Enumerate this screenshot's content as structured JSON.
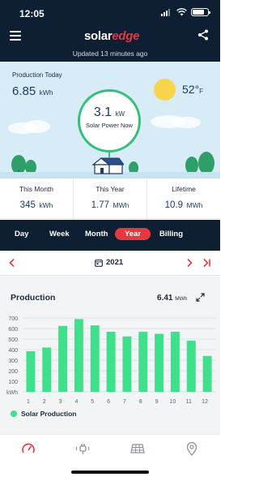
{
  "status_bar": {
    "time": "12:05"
  },
  "header": {
    "brand_left": "solar",
    "brand_right": "edge",
    "updated": "Updated 13 minutes ago",
    "menu_icon": "hamburger-menu-icon",
    "share_icon": "share-icon"
  },
  "hero": {
    "production_label": "Production Today",
    "production_value": "6.85",
    "production_unit": "kWh",
    "temperature": "52°",
    "temperature_unit": "F",
    "weather_icon": "sun-icon",
    "power_value": "3.1",
    "power_unit": "kW",
    "power_label": "Solar Power Now"
  },
  "stats": [
    {
      "label": "This Month",
      "value": "345",
      "unit": "kWh"
    },
    {
      "label": "This Year",
      "value": "1.77",
      "unit": "MWh"
    },
    {
      "label": "Lifetime",
      "value": "10.9",
      "unit": "MWh"
    }
  ],
  "tabs": [
    {
      "label": "Day",
      "active": false
    },
    {
      "label": "Week",
      "active": false
    },
    {
      "label": "Month",
      "active": false
    },
    {
      "label": "Year",
      "active": true
    },
    {
      "label": "Billing",
      "active": false
    }
  ],
  "period_nav": {
    "label": "2021",
    "calendar_icon": "calendar-icon"
  },
  "card": {
    "title": "Production",
    "total_value": "6.41",
    "total_unit": "MWh",
    "legend": "Solar Production"
  },
  "colors": {
    "navy": "#0e1f33",
    "accent_red": "#e6383f",
    "bar_green": "#3ee08b",
    "gauge_green": "#33c17a"
  },
  "chart_data": {
    "type": "bar",
    "categories": [
      "1",
      "2",
      "3",
      "4",
      "5",
      "6",
      "7",
      "8",
      "9",
      "10",
      "11",
      "12"
    ],
    "values": [
      385,
      420,
      625,
      690,
      630,
      570,
      525,
      570,
      550,
      570,
      485,
      340
    ],
    "ylim": [
      0,
      700
    ],
    "yticks": [
      0,
      100,
      200,
      300,
      400,
      500,
      600,
      700
    ],
    "ytick_labels": [
      "kWh",
      "100",
      "200",
      "300",
      "400",
      "500",
      "600",
      "700"
    ],
    "grid": true,
    "legend_position": "bottom-left"
  },
  "bottom_nav": [
    {
      "icon": "dashboard-gauge-icon",
      "active": true
    },
    {
      "icon": "ev-charger-plug-icon",
      "active": false
    },
    {
      "icon": "solar-panel-layout-icon",
      "active": false
    },
    {
      "icon": "location-pin-icon",
      "active": false
    }
  ]
}
